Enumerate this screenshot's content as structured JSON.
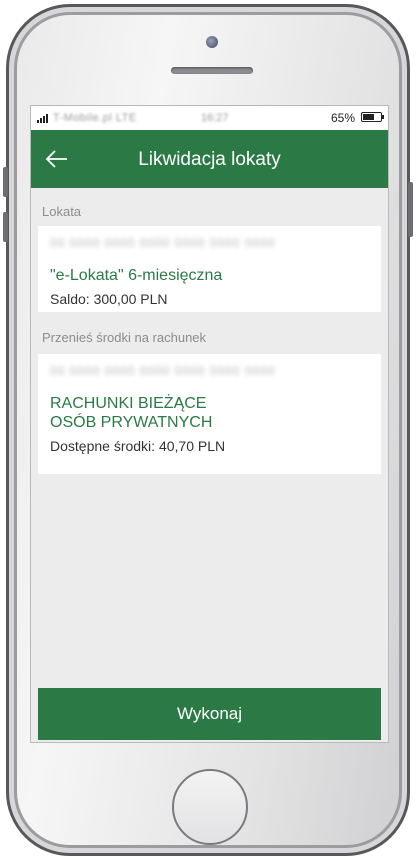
{
  "status_bar": {
    "carrier": "T-Mobile.pl LTE",
    "time": "16:27",
    "battery_percent": "65%"
  },
  "header": {
    "back_icon": "arrow-left-icon",
    "title": "Likwidacja lokaty"
  },
  "deposit_section": {
    "label": "Lokata",
    "account_number": "00 0000 0000 0000 0000 0000 0000",
    "name": "\"e-Lokata\" 6-miesięczna",
    "balance": "Saldo: 300,00 PLN"
  },
  "transfer_section": {
    "label": "Przenieś środki na rachunek",
    "account_number": "00 0000 0000 0000 0000 0000 0000",
    "name_line1": "RACHUNKI BIEŻĄCE",
    "name_line2": "OSÓB PRYWATNYCH",
    "available": "Dostępne środki: 40,70 PLN"
  },
  "actions": {
    "execute_label": "Wykonaj"
  },
  "colors": {
    "brand_green": "#2b7a46",
    "background": "#ececec",
    "secondary_text": "#8c8c8c"
  }
}
